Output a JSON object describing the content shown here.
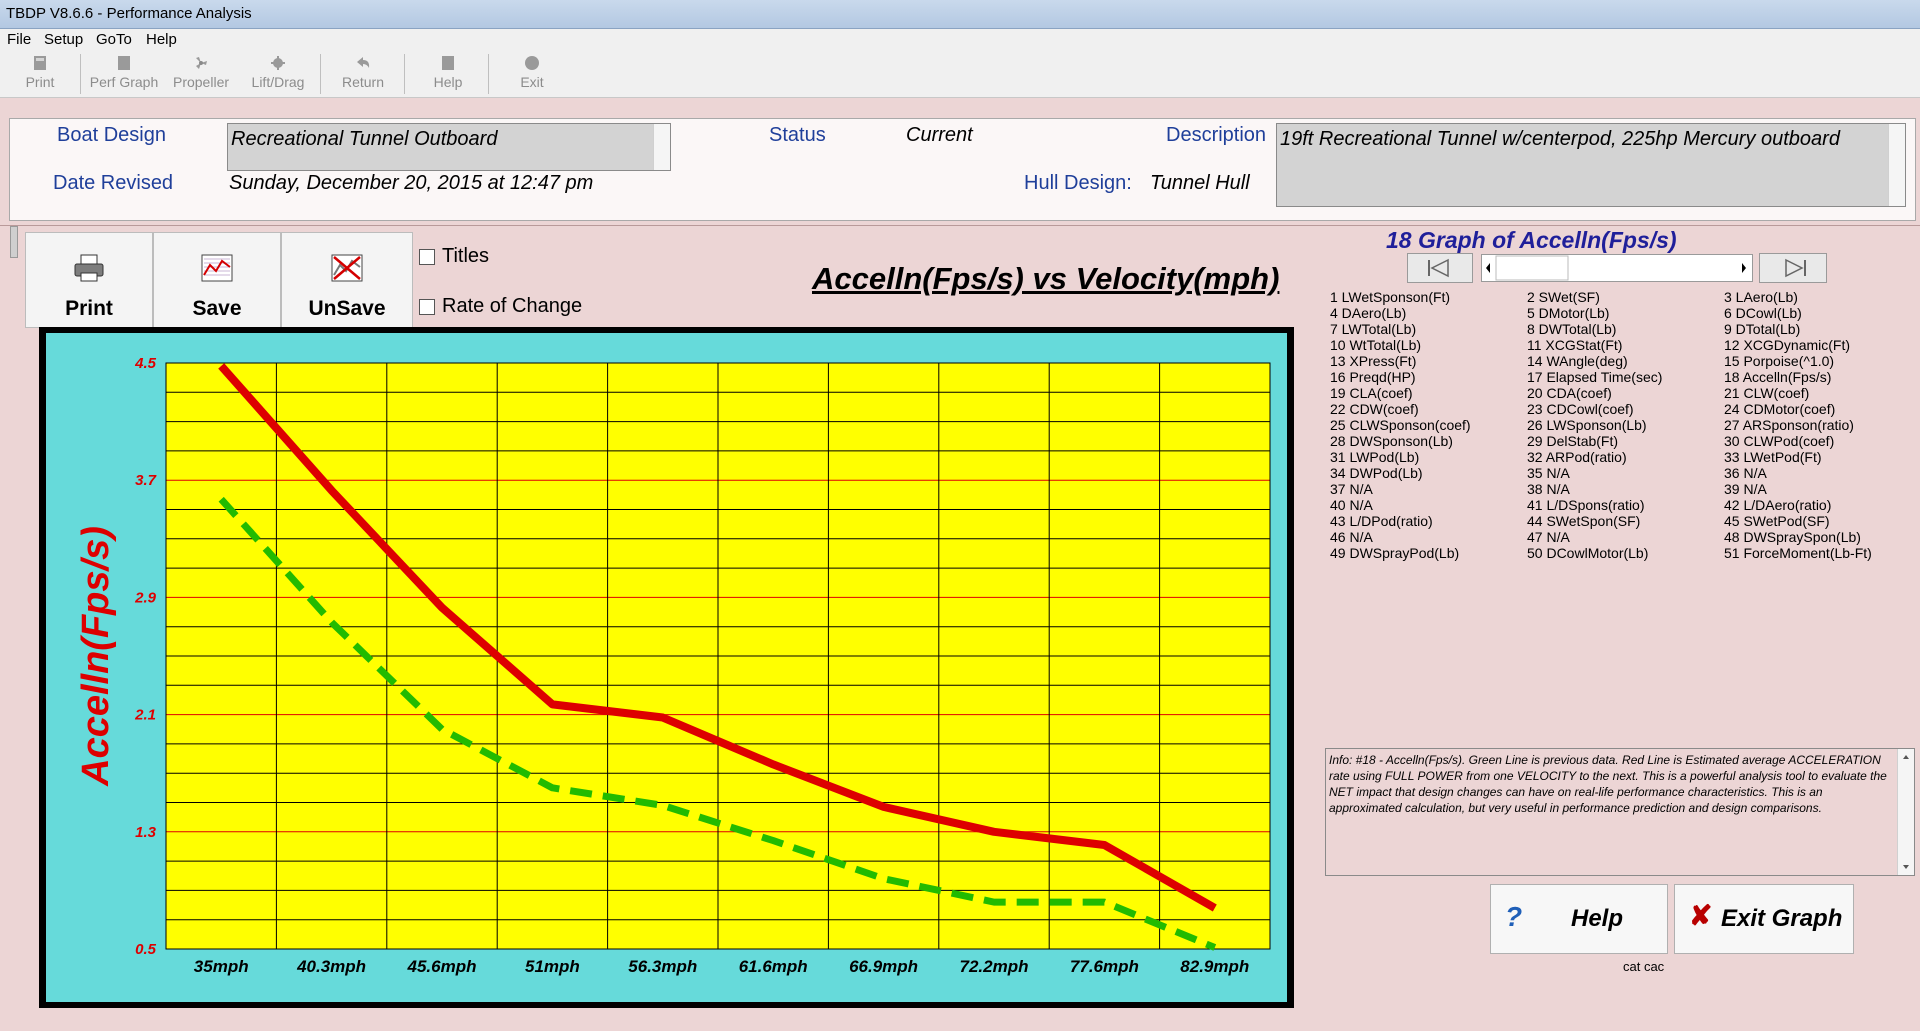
{
  "window": {
    "title": "TBDP V8.6.6 - Performance Analysis"
  },
  "menu": [
    "File",
    "Setup",
    "GoTo",
    "Help"
  ],
  "toolbar": [
    {
      "label": "Print",
      "icon": "printer-icon"
    },
    {
      "label": "Perf Graph",
      "icon": "graph-icon"
    },
    {
      "label": "Propeller",
      "icon": "propeller-icon"
    },
    {
      "label": "Lift/Drag",
      "icon": "lift-drag-icon"
    },
    {
      "label": "Return",
      "icon": "return-icon"
    },
    {
      "label": "Help",
      "icon": "help-icon"
    },
    {
      "label": "Exit",
      "icon": "exit-icon"
    }
  ],
  "header": {
    "boat_design_label": "Boat Design",
    "boat_design_value": "Recreational Tunnel Outboard",
    "status_label": "Status",
    "status_value": "Current",
    "description_label": "Description",
    "description_value": "19ft Recreational Tunnel w/centerpod, 225hp Mercury outboard",
    "date_revised_label": "Date Revised",
    "date_revised_value": "Sunday, December 20, 2015 at 12:47 pm",
    "hull_design_label": "Hull Design:",
    "hull_design_value": "Tunnel Hull"
  },
  "buttons": {
    "print": "Print",
    "save": "Save",
    "unsave": "UnSave"
  },
  "options": {
    "titles": "Titles",
    "rate_of_change": "Rate of Change"
  },
  "right_panel": {
    "title": "18 Graph of Accelln(Fps/s)",
    "variables": [
      "1 LWetSponson(Ft)",
      "2 SWet(SF)",
      "3 LAero(Lb)",
      "4 DAero(Lb)",
      "5 DMotor(Lb)",
      "6 DCowl(Lb)",
      "7 LWTotal(Lb)",
      "8 DWTotal(Lb)",
      "9 DTotal(Lb)",
      "10 WtTotal(Lb)",
      "11 XCGStat(Ft)",
      "12 XCGDynamic(Ft)",
      "13 XPress(Ft)",
      "14 WAngle(deg)",
      "15 Porpoise(^1.0)",
      "16 Preqd(HP)",
      "17 Elapsed Time(sec)",
      "18 Accelln(Fps/s)",
      "19 CLA(coef)",
      "20 CDA(coef)",
      "21 CLW(coef)",
      "22 CDW(coef)",
      "23 CDCowl(coef)",
      "24 CDMotor(coef)",
      "25 CLWSponson(coef)",
      "26 LWSponson(Lb)",
      "27 ARSponson(ratio)",
      "28 DWSponson(Lb)",
      "29 DelStab(Ft)",
      "30 CLWPod(coef)",
      "31 LWPod(Lb)",
      "32 ARPod(ratio)",
      "33 LWetPod(Ft)",
      "34 DWPod(Lb)",
      "35 N/A",
      "36 N/A",
      "37 N/A",
      "38 N/A",
      "39 N/A",
      "40 N/A",
      "41 L/DSpons(ratio)",
      "42 L/DAero(ratio)",
      "43 L/DPod(ratio)",
      "44 SWetSpon(SF)",
      "45 SWetPod(SF)",
      "46 N/A",
      "47 N/A",
      "48 DWSpraySpon(Lb)",
      "49 DWSprayPod(Lb)",
      "50 DCowlMotor(Lb)",
      "51 ForceMoment(Lb-Ft)"
    ],
    "info": "Info: #18 - Accelln(Fps/s). Green Line is previous data. Red Line is Estimated average ACCELERATION rate using FULL POWER from one VELOCITY to the next. This is a powerful analysis tool to evaluate the NET impact that design changes can have on real-life performance characteristics.  This is an approximated calculation, but very useful in performance prediction and design comparisons.",
    "help_button": "Help",
    "exit_button": "Exit Graph",
    "footer": "cat cac"
  },
  "chart_data": {
    "type": "line",
    "title": "Accelln(Fps/s) vs Velocity(mph)",
    "ylabel": "Accelln(Fps/s)",
    "xlabel": "",
    "categories": [
      "35mph",
      "40.3mph",
      "45.6mph",
      "51mph",
      "56.3mph",
      "61.6mph",
      "66.9mph",
      "72.2mph",
      "77.6mph",
      "82.9mph"
    ],
    "y_ticks": [
      "4.5",
      "3.7",
      "2.9",
      "2.1",
      "1.3",
      "0.5"
    ],
    "ylim": [
      0.5,
      4.5
    ],
    "grid": true,
    "background": "#ffff00",
    "series": [
      {
        "color": "#dd0000",
        "style": "solid",
        "x": [
          0.5,
          1.5,
          2.5,
          3.5,
          4.5,
          5.5,
          6.5,
          7.5,
          8.5,
          9.5
        ],
        "values": [
          4.48,
          3.63,
          2.83,
          2.17,
          2.08,
          1.76,
          1.47,
          1.3,
          1.21,
          0.78
        ]
      },
      {
        "color": "#22bb00",
        "style": "dashed",
        "x": [
          0.5,
          1.5,
          2.5,
          3.5,
          4.5,
          5.5,
          6.5,
          7.5,
          8.5,
          9.5
        ],
        "values": [
          3.57,
          2.73,
          2.0,
          1.6,
          1.48,
          1.24,
          0.98,
          0.82,
          0.82,
          0.51
        ]
      }
    ]
  },
  "colors": {
    "background": "#ecd5d5",
    "graph_frame_bg": "#66dada",
    "plot_bg": "#ffff00",
    "label_blue": "#1f3f9a",
    "axis_red": "#dd0000"
  }
}
